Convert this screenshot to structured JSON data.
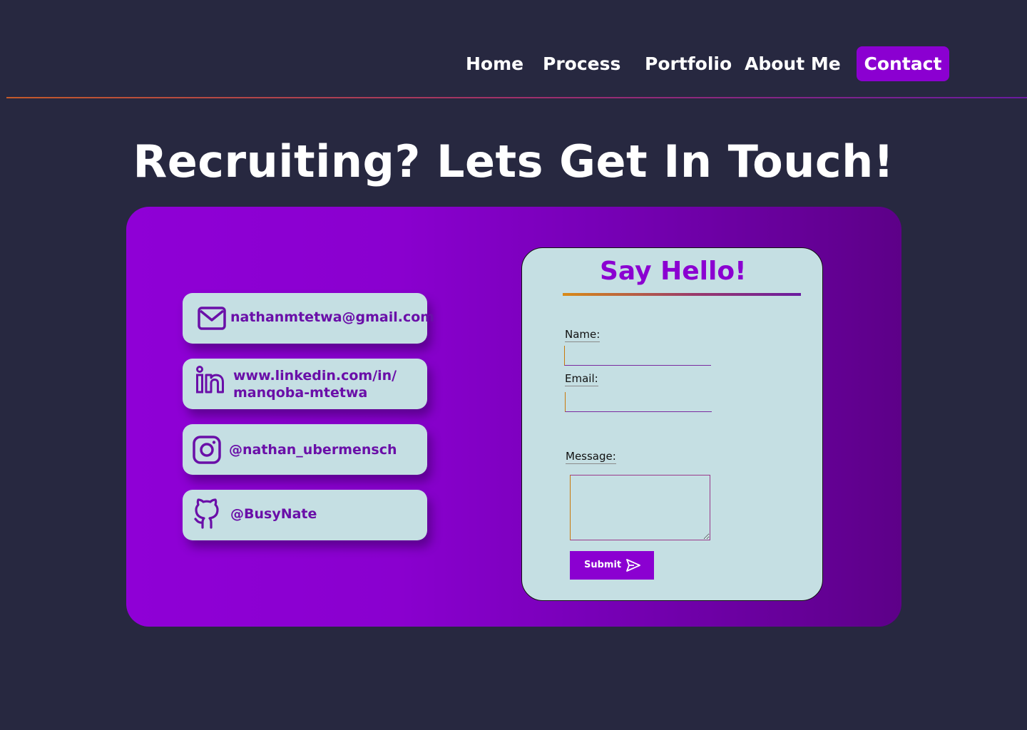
{
  "nav": {
    "items": [
      "Home",
      "Process",
      "Portfolio",
      "About Me"
    ],
    "contact": "Contact"
  },
  "headline": "Recruiting? Lets Get In Touch!",
  "contacts": [
    {
      "icon": "mail-icon",
      "text": "nathanmtetwa@gmail.com"
    },
    {
      "icon": "linkedin-icon",
      "line1": "www.linkedin.com/in/",
      "line2": "manqoba-mtetwa"
    },
    {
      "icon": "instagram-icon",
      "text": "@nathan_ubermensch"
    },
    {
      "icon": "github-icon",
      "text": "@BusyNate"
    }
  ],
  "form": {
    "title": "Say Hello!",
    "name_label": "Name:",
    "email_label": "Email:",
    "message_label": "Message:",
    "submit_label": "Submit",
    "submit_icon": "send-icon"
  },
  "colors": {
    "background": "#272840",
    "accent": "#8b00d1",
    "card": "#c5dfe3",
    "card_text": "#6a0fa8"
  }
}
